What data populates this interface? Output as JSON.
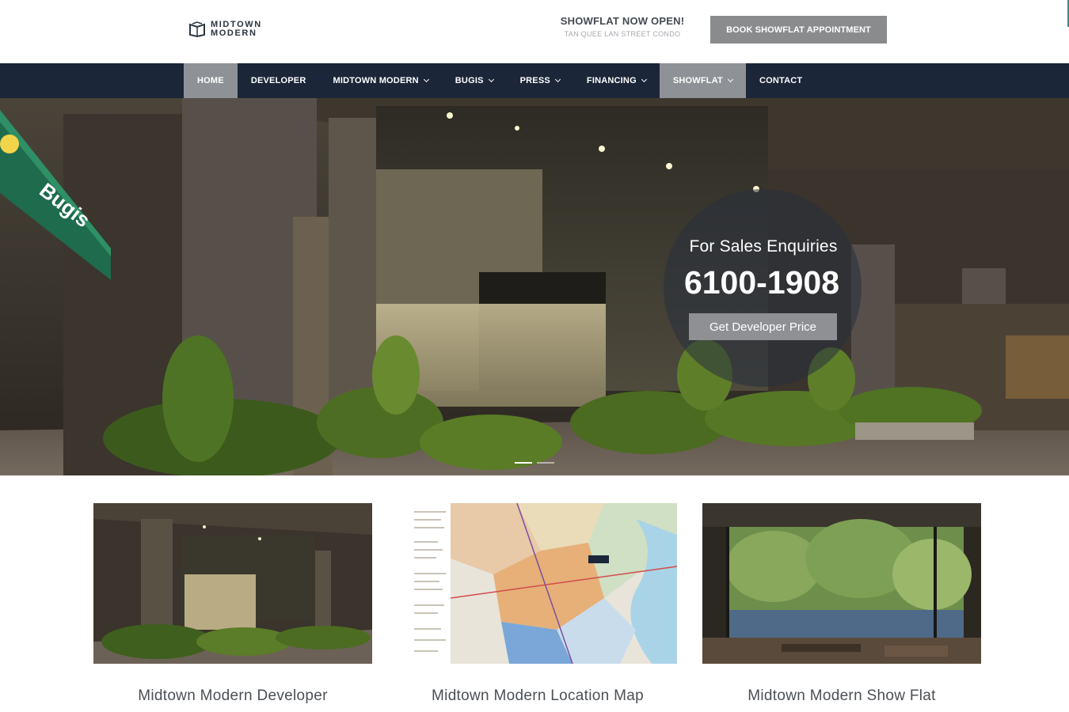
{
  "header": {
    "logo_line1": "MIDTOWN",
    "logo_line2": "MODERN",
    "showflat_title": "SHOWFLAT NOW OPEN!",
    "showflat_sub": "TAN QUEE LAN STREET CONDO",
    "book_button": "BOOK SHOWFLAT APPOINTMENT"
  },
  "nav": {
    "items": [
      {
        "label": "HOME"
      },
      {
        "label": "DEVELOPER"
      },
      {
        "label": "MIDTOWN MODERN"
      },
      {
        "label": "BUGIS"
      },
      {
        "label": "PRESS"
      },
      {
        "label": "FINANCING"
      },
      {
        "label": "SHOWFLAT"
      },
      {
        "label": "CONTACT"
      }
    ]
  },
  "hero": {
    "sign_text": "Bugis",
    "enquiry_title": "For Sales Enquiries",
    "phone": "6100-1908",
    "cta": "Get Developer Price"
  },
  "cards": [
    {
      "caption": "Midtown Modern Developer"
    },
    {
      "caption": "Midtown Modern Location Map"
    },
    {
      "caption": "Midtown Modern Show Flat"
    }
  ],
  "colors": {
    "nav_bg": "#1b2638",
    "active_bg": "#8e9296",
    "button_grey": "#8a8b8d"
  }
}
